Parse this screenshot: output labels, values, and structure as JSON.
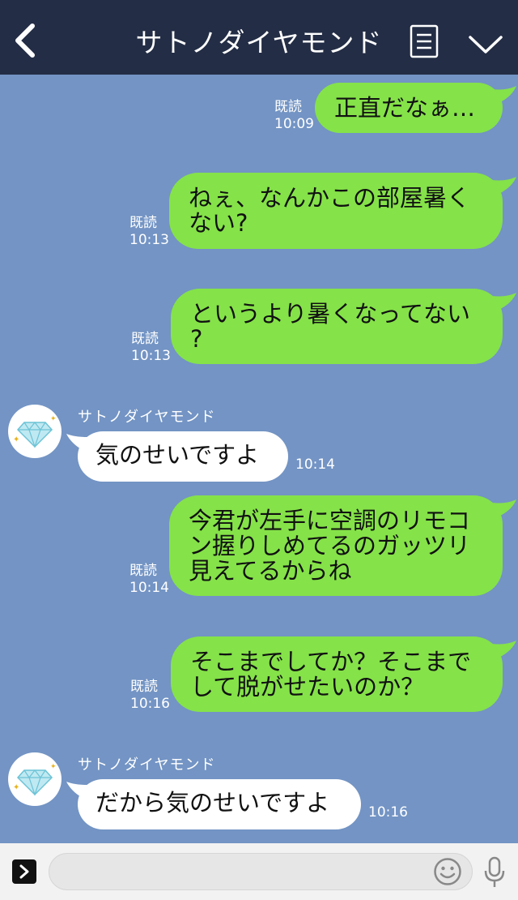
{
  "header": {
    "title": "サトノダイヤモンド"
  },
  "contact": {
    "name": "サトノダイヤモンド"
  },
  "messages": [
    {
      "side": "out",
      "lines": [
        "正直だなぁ…"
      ],
      "read": "既読",
      "time": "10:09"
    },
    {
      "side": "out",
      "lines": [
        "ねぇ、なんかこの部屋暑く",
        "ない?"
      ],
      "read": "既読",
      "time": "10:13"
    },
    {
      "side": "out",
      "lines": [
        "というより暑くなってない",
        "?"
      ],
      "read": "既読",
      "time": "10:13"
    },
    {
      "side": "in",
      "sender": "サトノダイヤモンド",
      "lines": [
        "気のせいですよ"
      ],
      "time": "10:14"
    },
    {
      "side": "out",
      "lines": [
        "今君が左手に空調のリモコ",
        "ン握りしめてるのガッツリ",
        "見えてるからね"
      ],
      "read": "既読",
      "time": "10:14"
    },
    {
      "side": "out",
      "lines": [
        "そこまでしてか？そこまで",
        "して脱がせたいのか？"
      ],
      "read": "既読",
      "time": "10:16"
    },
    {
      "side": "in",
      "sender": "サトノダイヤモンド",
      "lines": [
        "だから気のせいですよ"
      ],
      "time": "10:16"
    }
  ],
  "colors": {
    "header": "#232d45",
    "chat_background": "#7394c4",
    "outgoing_bubble": "#85e249",
    "incoming_bubble": "#ffffff"
  },
  "icons": [
    "back-arrow-icon",
    "menu-list-icon",
    "chevron-down-icon",
    "expand-icon",
    "emoji-icon",
    "microphone-icon"
  ]
}
